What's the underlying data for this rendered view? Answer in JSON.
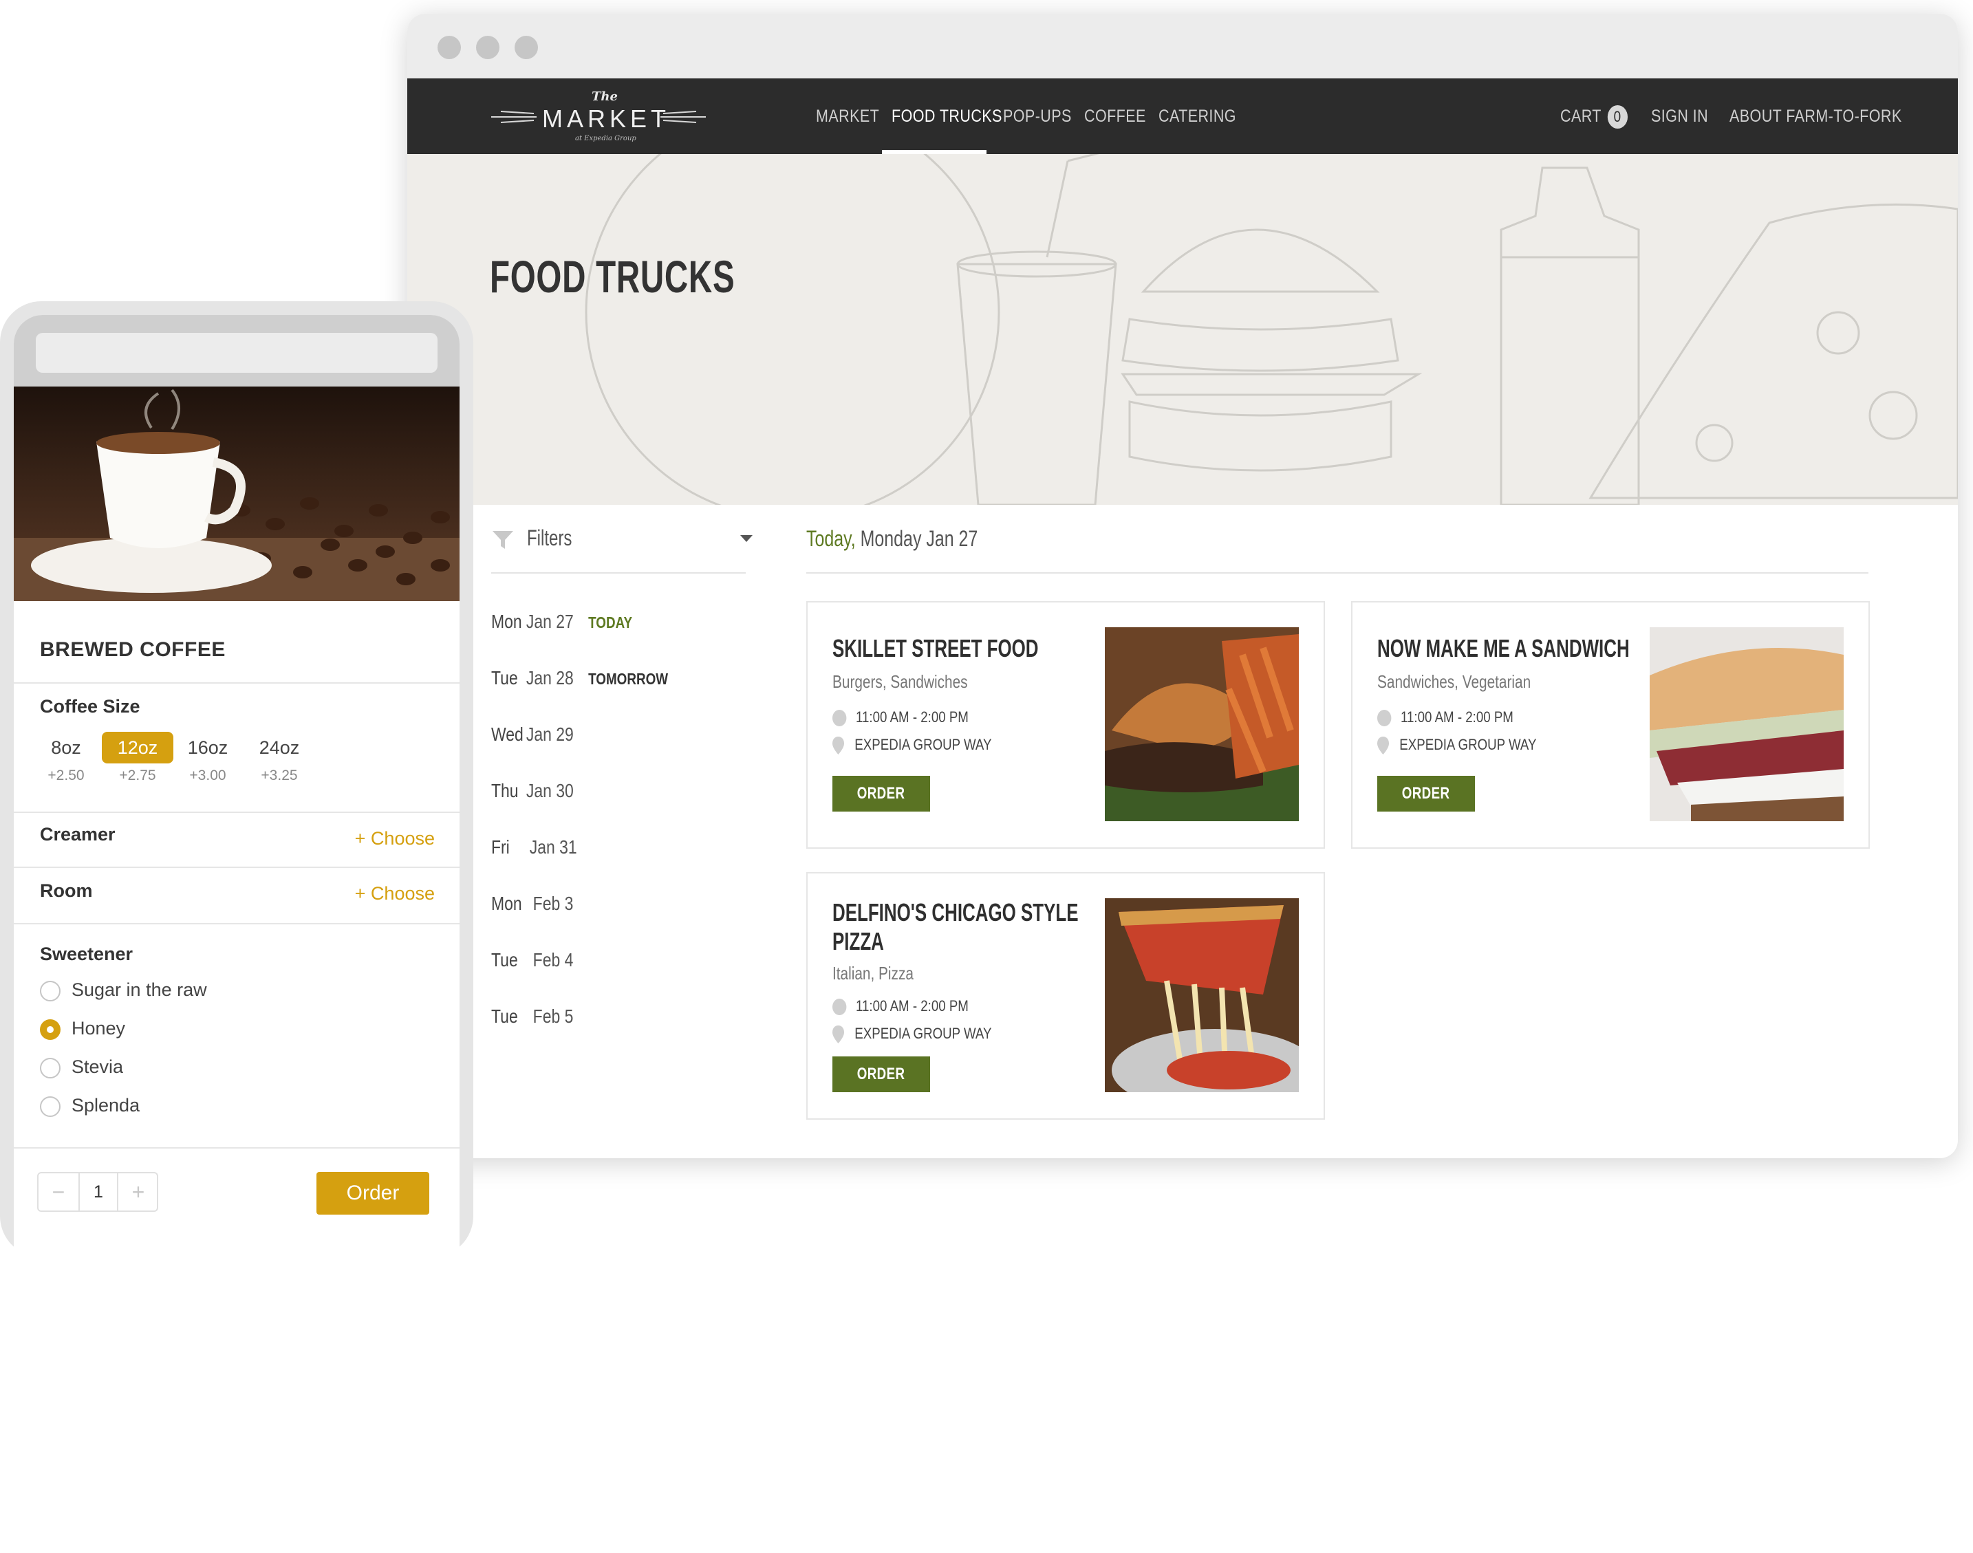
{
  "desktop": {
    "nav": {
      "links": [
        "MARKET",
        "FOOD TRUCKS",
        "POP-UPS",
        "COFFEE",
        "CATERING"
      ],
      "active": "FOOD TRUCKS",
      "cart_label": "CART",
      "cart_count": "0",
      "sign_in": "SIGN IN",
      "about": "ABOUT FARM-TO-FORK"
    },
    "logo": {
      "the": "The",
      "word": "MARKET",
      "sub": "at Expedia Group"
    },
    "hero_title": "FOOD TRUCKS",
    "filters_label": "Filters",
    "days": [
      {
        "dow": "Mon",
        "date": "Jan 27",
        "tag": "TODAY"
      },
      {
        "dow": "Tue",
        "date": "Jan 28",
        "tag": "TOMORROW"
      },
      {
        "dow": "Wed",
        "date": "Jan 29",
        "tag": ""
      },
      {
        "dow": "Thu",
        "date": "Jan 30",
        "tag": ""
      },
      {
        "dow": "Fri",
        "date": "Jan 31",
        "tag": ""
      },
      {
        "dow": "Mon",
        "date": "Feb 3",
        "tag": ""
      },
      {
        "dow": "Tue",
        "date": "Feb 4",
        "tag": ""
      },
      {
        "dow": "Tue",
        "date": "Feb 5",
        "tag": ""
      }
    ],
    "heading": {
      "today": "Today,",
      "rest": " Monday Jan 27"
    },
    "trucks": [
      {
        "name": "SKILLET STREET FOOD",
        "cats": "Burgers, Sandwiches",
        "hours": "11:00 AM - 2:00 PM",
        "location": "EXPEDIA GROUP WAY",
        "order": "ORDER"
      },
      {
        "name": "NOW MAKE ME A SANDWICH",
        "cats": "Sandwiches, Vegetarian",
        "hours": "11:00 AM - 2:00 PM",
        "location": "EXPEDIA GROUP WAY",
        "order": "ORDER"
      },
      {
        "name": "DELFINO'S CHICAGO STYLE PIZZA",
        "cats": "Italian, Pizza",
        "hours": "11:00 AM - 2:00 PM",
        "location": "EXPEDIA GROUP WAY",
        "order": "ORDER"
      }
    ],
    "colors": {
      "nav_bg": "#2c2c2c",
      "accent_green": "#5a7323",
      "today_green": "#5e7a22"
    }
  },
  "mobile": {
    "product": "BREWED COFFEE",
    "size_label": "Coffee Size",
    "sizes": [
      {
        "size": "8oz",
        "price": "+2.50"
      },
      {
        "size": "12oz",
        "price": "+2.75"
      },
      {
        "size": "16oz",
        "price": "+3.00"
      },
      {
        "size": "24oz",
        "price": "+3.25"
      }
    ],
    "selected_size": "12oz",
    "creamer_label": "Creamer",
    "room_label": "Room",
    "choose": "+ Choose",
    "sweetener_label": "Sweetener",
    "sweeteners": [
      "Sugar in the raw",
      "Honey",
      "Stevia",
      "Splenda"
    ],
    "selected_sweetener": "Honey",
    "quantity": "1",
    "minus": "−",
    "plus": "+",
    "order_label": "Order",
    "colors": {
      "accent_gold": "#d5a010"
    }
  }
}
